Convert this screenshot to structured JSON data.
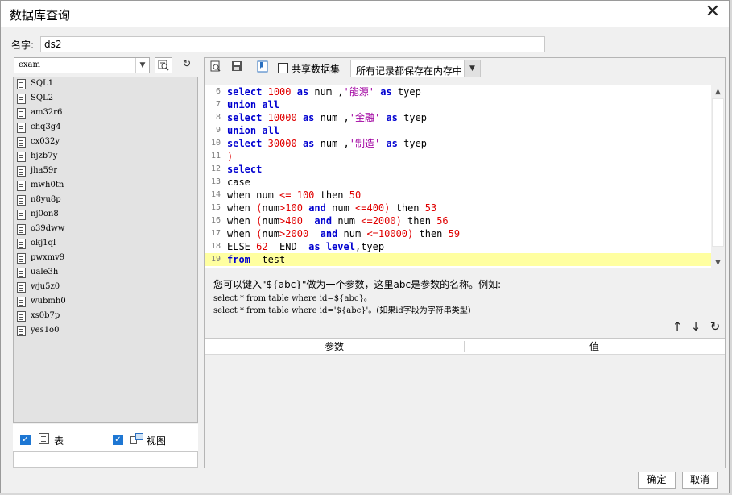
{
  "window": {
    "title": "数据库查询",
    "close_glyph": "✕"
  },
  "name_field": {
    "label": "名字:",
    "value": "ds2"
  },
  "left_panel": {
    "database_value": "exam",
    "tables": [
      "SQL1",
      "SQL2",
      "am32r6",
      "chq3g4",
      "cx032y",
      "hjzb7y",
      "jha59r",
      "mwh0tn",
      "n8yu8p",
      "nj0on8",
      "o39dww",
      "okj1ql",
      "pwxmv9",
      "uale3h",
      "wju5z0",
      "wubmh0",
      "xs0b7p",
      "yes1o0"
    ],
    "table_checkbox_label": "表",
    "view_checkbox_label": "视图",
    "table_checked": true,
    "view_checked": true
  },
  "toolbar": {
    "share_dataset_label": "共享数据集",
    "share_dataset_checked": false,
    "memory_option": "所有记录都保存在内存中"
  },
  "editor": {
    "lines": [
      {
        "n": "6",
        "tokens": [
          [
            "kw",
            "select"
          ],
          [
            "pln",
            " "
          ],
          [
            "num",
            "1000"
          ],
          [
            "pln",
            " "
          ],
          [
            "kw",
            "as"
          ],
          [
            "pln",
            " num ,"
          ],
          [
            "str",
            "'能源'"
          ],
          [
            "pln",
            " "
          ],
          [
            "kw",
            "as"
          ],
          [
            "pln",
            " tyep"
          ]
        ]
      },
      {
        "n": "7",
        "tokens": [
          [
            "kw",
            "union all"
          ]
        ]
      },
      {
        "n": "8",
        "tokens": [
          [
            "kw",
            "select"
          ],
          [
            "pln",
            " "
          ],
          [
            "num",
            "10000"
          ],
          [
            "pln",
            " "
          ],
          [
            "kw",
            "as"
          ],
          [
            "pln",
            " num ,"
          ],
          [
            "str",
            "'金融'"
          ],
          [
            "pln",
            " "
          ],
          [
            "kw",
            "as"
          ],
          [
            "pln",
            " tyep"
          ]
        ]
      },
      {
        "n": "9",
        "tokens": [
          [
            "kw",
            "union all"
          ]
        ]
      },
      {
        "n": "10",
        "tokens": [
          [
            "kw",
            "select"
          ],
          [
            "pln",
            " "
          ],
          [
            "num",
            "30000"
          ],
          [
            "pln",
            " "
          ],
          [
            "kw",
            "as"
          ],
          [
            "pln",
            " num ,"
          ],
          [
            "str",
            "'制造'"
          ],
          [
            "pln",
            " "
          ],
          [
            "kw",
            "as"
          ],
          [
            "pln",
            " tyep"
          ]
        ]
      },
      {
        "n": "11",
        "tokens": [
          [
            "op",
            ")"
          ]
        ]
      },
      {
        "n": "12",
        "tokens": [
          [
            "kw",
            "select"
          ]
        ]
      },
      {
        "n": "13",
        "tokens": [
          [
            "pln",
            "case"
          ]
        ]
      },
      {
        "n": "14",
        "tokens": [
          [
            "pln",
            "when num "
          ],
          [
            "op",
            "<="
          ],
          [
            "pln",
            " "
          ],
          [
            "num",
            "100"
          ],
          [
            "pln",
            " then "
          ],
          [
            "num",
            "50"
          ]
        ]
      },
      {
        "n": "15",
        "tokens": [
          [
            "pln",
            "when "
          ],
          [
            "op",
            "("
          ],
          [
            "pln",
            "num"
          ],
          [
            "op",
            ">"
          ],
          [
            "num",
            "100"
          ],
          [
            "pln",
            " "
          ],
          [
            "kw",
            "and"
          ],
          [
            "pln",
            " num "
          ],
          [
            "op",
            "<="
          ],
          [
            "num",
            "400"
          ],
          [
            "op",
            ")"
          ],
          [
            "pln",
            " then "
          ],
          [
            "num",
            "53"
          ]
        ]
      },
      {
        "n": "16",
        "tokens": [
          [
            "pln",
            "when "
          ],
          [
            "op",
            "("
          ],
          [
            "pln",
            "num"
          ],
          [
            "op",
            ">"
          ],
          [
            "num",
            "400"
          ],
          [
            "pln",
            "  "
          ],
          [
            "kw",
            "and"
          ],
          [
            "pln",
            " num "
          ],
          [
            "op",
            "<="
          ],
          [
            "num",
            "2000"
          ],
          [
            "op",
            ")"
          ],
          [
            "pln",
            " then "
          ],
          [
            "num",
            "56"
          ]
        ]
      },
      {
        "n": "17",
        "tokens": [
          [
            "pln",
            "when "
          ],
          [
            "op",
            "("
          ],
          [
            "pln",
            "num"
          ],
          [
            "op",
            ">"
          ],
          [
            "num",
            "2000"
          ],
          [
            "pln",
            "  "
          ],
          [
            "kw",
            "and"
          ],
          [
            "pln",
            " num "
          ],
          [
            "op",
            "<="
          ],
          [
            "num",
            "10000"
          ],
          [
            "op",
            ")"
          ],
          [
            "pln",
            " then "
          ],
          [
            "num",
            "59"
          ]
        ]
      },
      {
        "n": "18",
        "tokens": [
          [
            "pln",
            "ELSE "
          ],
          [
            "num",
            "62"
          ],
          [
            "pln",
            "  END  "
          ],
          [
            "kw",
            "as"
          ],
          [
            "pln",
            " "
          ],
          [
            "kw",
            "level"
          ],
          [
            "pln",
            ",tyep"
          ]
        ]
      },
      {
        "n": "19",
        "tokens": [
          [
            "kw",
            "from"
          ],
          [
            "pln",
            "  test"
          ]
        ]
      }
    ]
  },
  "help": {
    "line1": "您可以键入\"${abc}\"做为一个参数，这里abc是参数的名称。例如:",
    "line2": "select * from table where id=${abc}。",
    "line3": "select * from table where id='${abc}'。(如果id字段为字符串类型)"
  },
  "param_table": {
    "col_param": "参数",
    "col_value": "值"
  },
  "buttons": {
    "ok": "确定",
    "cancel": "取消"
  },
  "colors": {
    "keyword": "#0000d0",
    "string": "#a000a0",
    "number": "#e00000",
    "current_line": "#ffffa0",
    "checkbox": "#1e77d3"
  }
}
